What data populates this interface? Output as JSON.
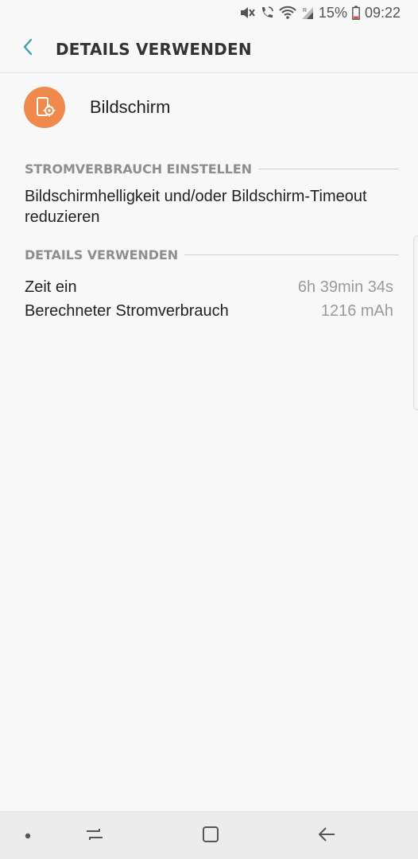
{
  "status_bar": {
    "battery_percent": "15%",
    "time": "09:22",
    "icons": [
      "mute-icon",
      "wifi-call-icon",
      "wifi-icon",
      "signal-icon",
      "battery-icon"
    ]
  },
  "app_bar": {
    "title": "DETAILS VERWENDEN",
    "back_icon": "chevron-left-icon"
  },
  "header": {
    "label": "Bildschirm",
    "icon": "screen-settings-icon",
    "icon_color": "#ef8a4c"
  },
  "sections": {
    "power_settings": {
      "title": "STROMVERBRAUCH EINSTELLEN",
      "tip": "Bildschirmhelligkeit und/oder Bildschirm-Timeout reduzieren"
    },
    "usage_details": {
      "title": "DETAILS VERWENDEN",
      "rows": [
        {
          "label": "Zeit ein",
          "value": "6h 39min 34s"
        },
        {
          "label": "Berechneter Stromverbrauch",
          "value": "1216 mAh"
        }
      ]
    }
  },
  "nav_bar": {
    "buttons": [
      "dot-icon",
      "recent-apps-icon",
      "home-icon",
      "back-arrow-icon"
    ]
  },
  "colors": {
    "accent": "#3d9fb5",
    "background": "#f8f8f8"
  }
}
